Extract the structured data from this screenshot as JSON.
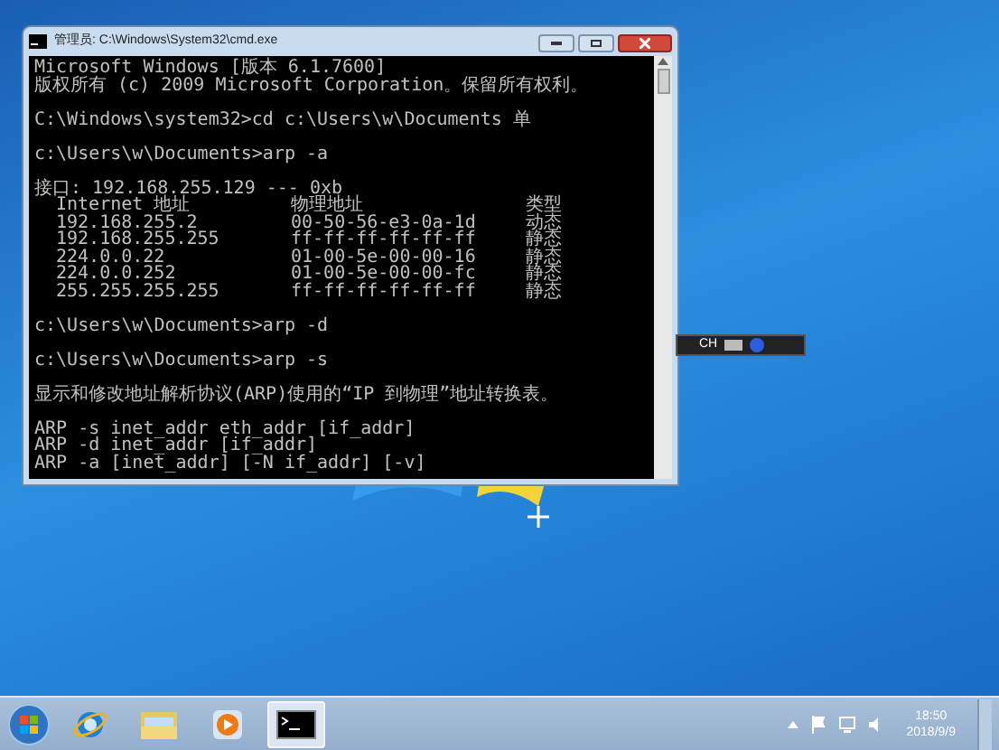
{
  "window": {
    "title": "管理员: C:\\Windows\\System32\\cmd.exe"
  },
  "console": [
    {
      "kind": "lines",
      "lines": [
        "Microsoft Windows [版本 6.1.7600]",
        "版权所有 (c) 2009 Microsoft Corporation。保留所有权利。"
      ]
    },
    {
      "kind": "lines",
      "lines": [
        "C:\\Windows\\system32>cd c:\\Users\\w\\Documents 单"
      ]
    },
    {
      "kind": "lines",
      "lines": [
        "c:\\Users\\w\\Documents>arp -a"
      ]
    },
    {
      "kind": "table",
      "interface": "接口: 192.168.255.129 --- 0xb",
      "columns": [
        "Internet 地址",
        "物理地址",
        "类型"
      ],
      "rows": [
        [
          "192.168.255.2",
          "00-50-56-e3-0a-1d",
          "动态"
        ],
        [
          "192.168.255.255",
          "ff-ff-ff-ff-ff-ff",
          "静态"
        ],
        [
          "224.0.0.22",
          "01-00-5e-00-00-16",
          "静态"
        ],
        [
          "224.0.0.252",
          "01-00-5e-00-00-fc",
          "静态"
        ],
        [
          "255.255.255.255",
          "ff-ff-ff-ff-ff-ff",
          "静态"
        ]
      ]
    },
    {
      "kind": "lines",
      "lines": [
        "c:\\Users\\w\\Documents>arp -d"
      ]
    },
    {
      "kind": "lines",
      "lines": [
        "c:\\Users\\w\\Documents>arp -s"
      ]
    },
    {
      "kind": "lines",
      "lines": [
        "显示和修改地址解析协议(ARP)使用的“IP 到物理”地址转换表。"
      ]
    },
    {
      "kind": "lines",
      "lines": [
        "ARP -s inet_addr eth_addr [if_addr]",
        "ARP -d inet_addr [if_addr]",
        "ARP -a [inet_addr] [-N if_addr] [-v]"
      ]
    }
  ],
  "language_bar": {
    "label": "CH"
  },
  "taskbar": {
    "items": [
      {
        "kind": "browser",
        "selected": false
      },
      {
        "kind": "folder",
        "selected": false
      },
      {
        "kind": "media",
        "selected": false
      },
      {
        "kind": "console",
        "selected": true
      }
    ],
    "clock": {
      "time": "18:50",
      "date": "2018/9/9"
    }
  }
}
